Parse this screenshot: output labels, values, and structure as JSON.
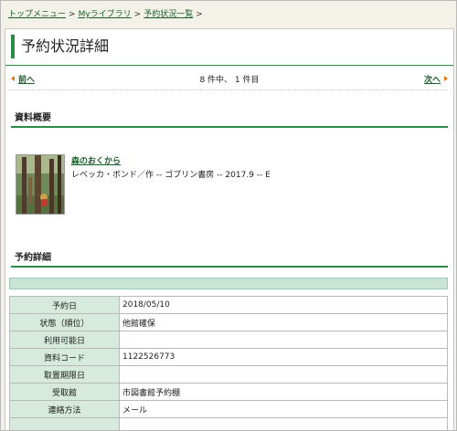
{
  "breadcrumb": {
    "items": [
      "トップメニュー",
      "Myライブラリ",
      "予約状況一覧"
    ],
    "separator": ">"
  },
  "page": {
    "title": "予約状況詳細"
  },
  "pager": {
    "prev": "前へ",
    "next": "次へ",
    "count": "8 件中、 1 件目"
  },
  "summary": {
    "heading": "資料概要",
    "book": {
      "title": "森のおくから",
      "meta": "レベッカ・ボンド／作 -- ゴブリン書房 -- 2017.9 -- E"
    }
  },
  "detail": {
    "heading": "予約詳細",
    "rows": [
      {
        "label": "予約日",
        "value": "2018/05/10"
      },
      {
        "label": "状態（順位）",
        "value": "他館確保"
      },
      {
        "label": "利用可能日",
        "value": ""
      },
      {
        "label": "資料コード",
        "value": "1122526773"
      },
      {
        "label": "取置期限日",
        "value": ""
      },
      {
        "label": "受取館",
        "value": "市図書館予約棚"
      },
      {
        "label": "連絡方法",
        "value": "メール"
      },
      {
        "label": "",
        "value": ""
      }
    ]
  },
  "colors": {
    "accent": "#2a8a46",
    "link": "#1a5e2a",
    "arrow": "#e07a12",
    "header_cell": "#d6eadd"
  }
}
